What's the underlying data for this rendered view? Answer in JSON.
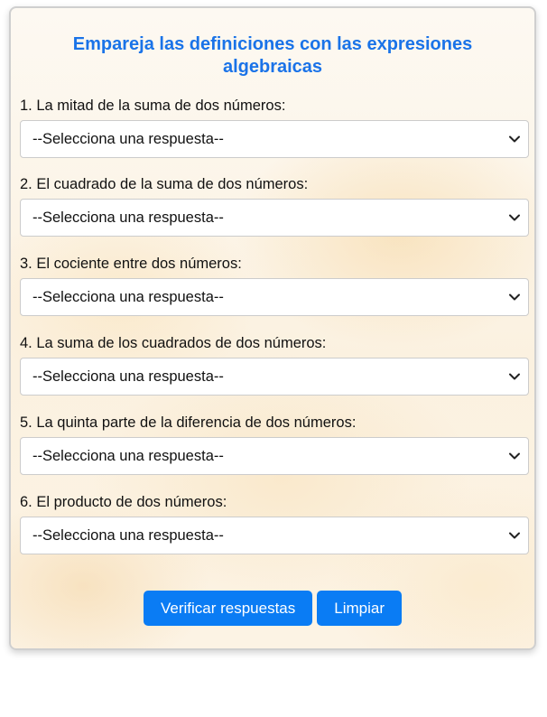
{
  "header": {
    "title": "Empareja las definiciones con las expresiones algebraicas"
  },
  "questions": [
    {
      "label": "1. La mitad de la suma de dos números:",
      "selected": "--Selecciona una respuesta--"
    },
    {
      "label": "2. El cuadrado de la suma de dos números:",
      "selected": "--Selecciona una respuesta--"
    },
    {
      "label": "3. El cociente entre dos números:",
      "selected": "--Selecciona una respuesta--"
    },
    {
      "label": "4. La suma de los cuadrados de dos números:",
      "selected": "--Selecciona una respuesta--"
    },
    {
      "label": "5. La quinta parte de la diferencia de dos números:",
      "selected": "--Selecciona una respuesta--"
    },
    {
      "label": "6. El producto de dos números:",
      "selected": "--Selecciona una respuesta--"
    }
  ],
  "actions": {
    "verify_label": "Verificar respuestas",
    "clear_label": "Limpiar"
  },
  "colors": {
    "accent": "#1a73e8",
    "button": "#0a7cf4"
  },
  "icons": {
    "select_arrow": "chevron-down-icon"
  }
}
